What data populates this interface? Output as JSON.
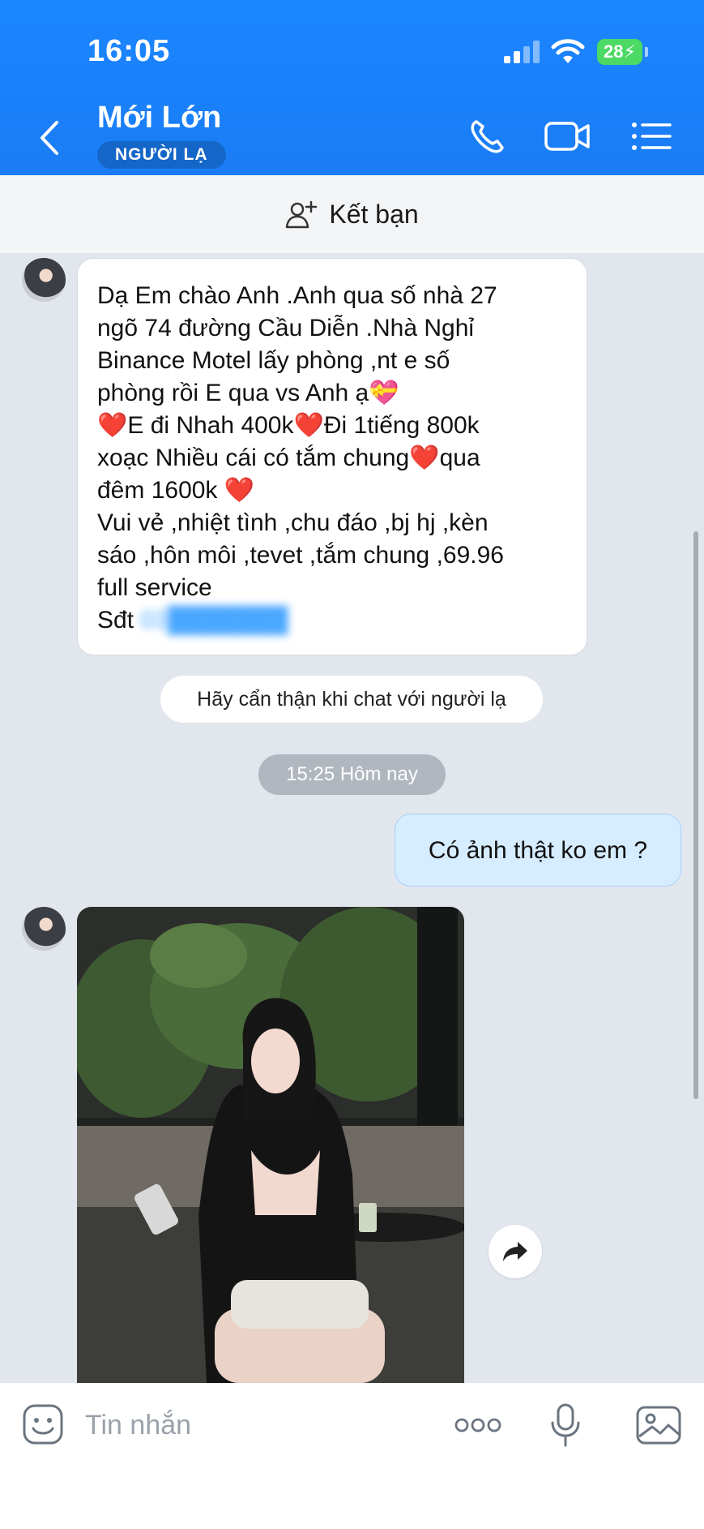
{
  "status_bar": {
    "time": "16:05",
    "battery": "28"
  },
  "header": {
    "name": "Mới Lớn",
    "badge": "NGƯỜI LẠ"
  },
  "friend_bar": {
    "label": "Kết bạn"
  },
  "messages": {
    "incoming_text_lines": [
      "Dạ Em chào Anh .Anh qua số nhà 27",
      "ngõ 74 đường Cầu Diễn .Nhà Nghỉ",
      "Binance Motel lấy phòng ,nt e số",
      "phòng rồi E qua vs  Anh ạ💝",
      "E đi Nhah 400k",
      "Đi 1tiếng 800k",
      "xoạc Nhiều cái có tắm chung",
      "qua",
      "đêm 1600k ",
      "Vui vẻ ,nhiệt tình ,chu đáo ,bj hj ,kèn",
      "sáo ,hôn môi ,tevet ,tắm chung ,69.96",
      "full service",
      "Sđt ",
      "03"
    ],
    "heart": "❤️",
    "warning": "Hãy cẩn thận khi chat với người lạ",
    "timestamp": "15:25 Hôm nay",
    "outgoing": "Có ảnh thật ko em ?"
  },
  "input": {
    "placeholder": "Tin nhắn"
  },
  "icons": {
    "back": "chevron-left-icon",
    "call": "phone-icon",
    "video": "video-camera-icon",
    "menu": "list-icon",
    "add_friend": "add-user-icon",
    "share": "forward-arrow-icon",
    "emoji": "emoji-icon",
    "more": "more-dots-icon",
    "mic": "microphone-icon",
    "image": "image-icon"
  },
  "colors": {
    "header": "#1a7cf5",
    "outgoing_bubble": "#d6ecff",
    "badge": "#1466c8"
  }
}
